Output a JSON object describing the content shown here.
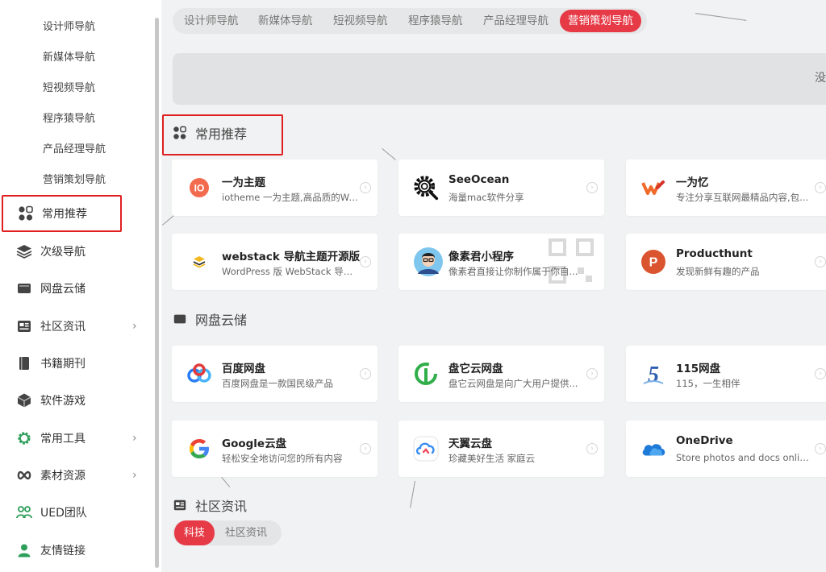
{
  "sidebar": {
    "sub_items": [
      {
        "label": "设计师导航"
      },
      {
        "label": "新媒体导航"
      },
      {
        "label": "短视频导航"
      },
      {
        "label": "程序猿导航"
      },
      {
        "label": "产品经理导航"
      },
      {
        "label": "营销策划导航"
      }
    ],
    "items": [
      {
        "label": "常用推荐",
        "icon": "grid-apps-icon",
        "active": true
      },
      {
        "label": "次级导航",
        "icon": "layers-icon"
      },
      {
        "label": "网盘云储",
        "icon": "folder-icon"
      },
      {
        "label": "社区资讯",
        "icon": "newspaper-icon",
        "arrow": "›"
      },
      {
        "label": "书籍期刊",
        "icon": "book-icon"
      },
      {
        "label": "软件游戏",
        "icon": "cube-icon"
      },
      {
        "label": "常用工具",
        "icon": "gear-icon",
        "arrow": "›"
      },
      {
        "label": "素材资源",
        "icon": "infinity-icon",
        "arrow": "›"
      },
      {
        "label": "UED团队",
        "icon": "team-icon"
      },
      {
        "label": "友情链接",
        "icon": "user-icon"
      }
    ]
  },
  "top_tabs": [
    {
      "label": "设计师导航"
    },
    {
      "label": "新媒体导航"
    },
    {
      "label": "短视频导航"
    },
    {
      "label": "程序猿导航"
    },
    {
      "label": "产品经理导航"
    },
    {
      "label": "营销策划导航",
      "active": true
    }
  ],
  "search": {
    "hint": "没"
  },
  "sections": {
    "recommended": {
      "title": "常用推荐",
      "cards": [
        {
          "title": "一为主题",
          "desc": "iotheme 一为主题,高品质的Wo...",
          "logo": "io-logo-icon"
        },
        {
          "title": "SeeOcean",
          "desc": "海量mac软件分享",
          "logo": "gear-search-logo-icon"
        },
        {
          "title": "一为忆",
          "desc": "专注分享互联网最精品内容,包...",
          "logo": "w-logo-icon"
        },
        {
          "title": "webstack 导航主题开源版",
          "desc": "WordPress 版 WebStack 导航主...",
          "logo": "stack-logo-icon"
        },
        {
          "title": "像素君小程序",
          "desc": "像素君直接让你制作属于你自...",
          "logo": "avatar-logo-icon"
        },
        {
          "title": "Producthunt",
          "desc": "发现新鲜有趣的产品",
          "logo": "p-logo-icon"
        }
      ]
    },
    "cloud": {
      "title": "网盘云储",
      "cards": [
        {
          "title": "百度网盘",
          "desc": "百度网盘是一款国民级产品",
          "logo": "baidu-cloud-logo-icon"
        },
        {
          "title": "盘它云网盘",
          "desc": "盘它云网盘是向广大用户提供...",
          "logo": "panta-logo-icon"
        },
        {
          "title": "115网盘",
          "desc": "115，一生相伴",
          "logo": "115-logo-icon"
        },
        {
          "title": "Google云盘",
          "desc": "轻松安全地访问您的所有内容",
          "logo": "google-logo-icon"
        },
        {
          "title": "天翼云盘",
          "desc": "珍藏美好生活 家庭云",
          "logo": "tianyi-logo-icon"
        },
        {
          "title": "OneDrive",
          "desc": "Store photos and docs online. ...",
          "logo": "onedrive-logo-icon"
        }
      ]
    },
    "community": {
      "title": "社区资讯",
      "tabs": [
        {
          "label": "科技",
          "active": true
        },
        {
          "label": "社区资讯"
        }
      ]
    }
  },
  "colors": {
    "accent": "#e63a47",
    "highlight_border": "#e02020",
    "page_bg": "#f1f2f3"
  }
}
